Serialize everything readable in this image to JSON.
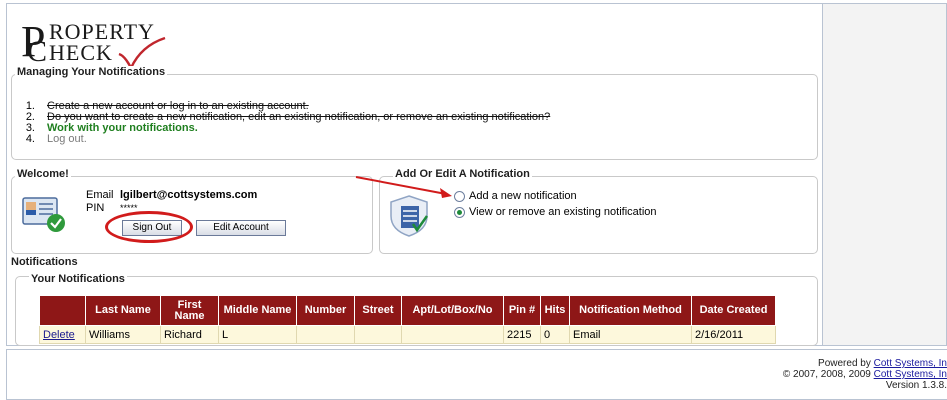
{
  "logo": {
    "line1": "ROPERTY",
    "line2": "HECK"
  },
  "managing": {
    "title": "Managing Your Notifications",
    "steps": [
      {
        "num": "1.",
        "text": "Create a new account or log in to an existing account."
      },
      {
        "num": "2.",
        "text": "Do you want to create a new notification, edit an existing notification, or remove an existing notification?"
      },
      {
        "num": "3.",
        "text": "Work with your notifications."
      },
      {
        "num": "4.",
        "text": "Log out."
      }
    ]
  },
  "welcome": {
    "title": "Welcome!",
    "email_label": "Email",
    "email_value": "lgilbert@cottsystems.com",
    "pin_label": "PIN",
    "pin_value": "*****",
    "sign_out": "Sign Out",
    "edit_account": "Edit Account"
  },
  "add_edit": {
    "title": "Add Or Edit A Notification",
    "options": [
      {
        "label": "Add a new notification",
        "checked": false
      },
      {
        "label": "View or remove an existing notification",
        "checked": true
      }
    ]
  },
  "notifications": {
    "title": "Notifications",
    "subtitle": "Your Notifications",
    "columns": [
      "",
      "Last Name",
      "First Name",
      "Middle Name",
      "Number",
      "Street",
      "Apt/Lot/Box/No",
      "Pin #",
      "Hits",
      "Notification Method",
      "Date Created"
    ],
    "rows": [
      {
        "action": "Delete",
        "last": "Williams",
        "first": "Richard",
        "middle": "L",
        "number": "",
        "street": "",
        "apt": "",
        "pin": "2215",
        "hits": "0",
        "method": "Email",
        "date": "2/16/2011"
      }
    ]
  },
  "footer": {
    "powered_prefix": "Powered by",
    "powered_link": "Cott Systems, In",
    "copyright": "© 2007, 2008, 2009",
    "copyright_link": "Cott Systems, In",
    "version": "Version 1.3.8."
  },
  "colors": {
    "table_header": "#8e1717",
    "row_bg": "#fdf8dc",
    "current_step": "#1f7f1f",
    "annotation": "#d11b1b"
  }
}
